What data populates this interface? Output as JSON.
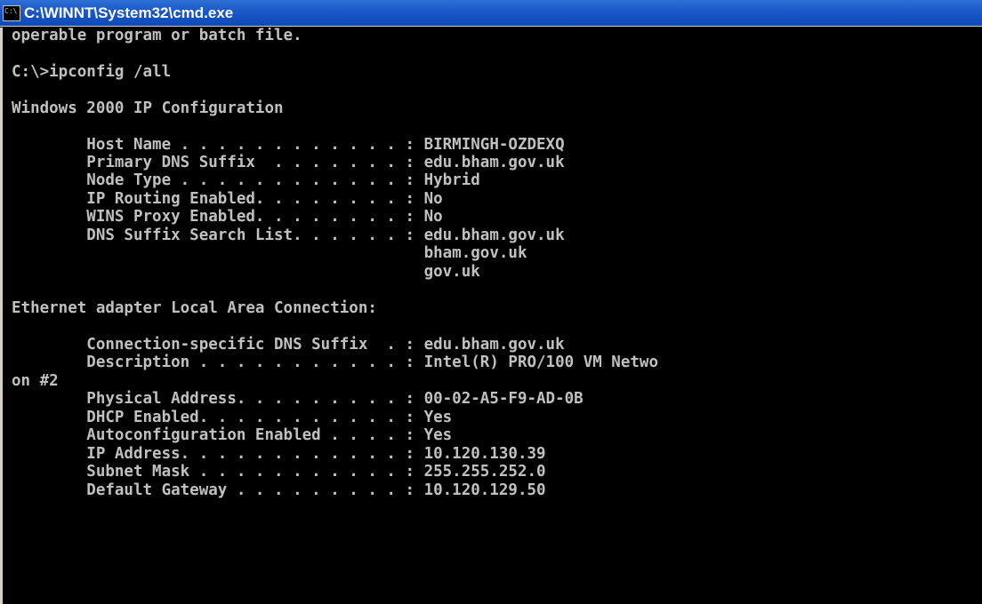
{
  "window": {
    "title": "C:\\WINNT\\System32\\cmd.exe",
    "icon": "console-app-icon"
  },
  "console": {
    "lines": [
      "operable program or batch file.",
      "C:\\>ipconfig /all",
      "Windows 2000 IP Configuration",
      "        Host Name . . . . . . . . . . . . : BIRMINGH-OZDEXQ",
      "        Primary DNS Suffix  . . . . . . . : edu.bham.gov.uk",
      "        Node Type . . . . . . . . . . . . : Hybrid",
      "        IP Routing Enabled. . . . . . . . : No",
      "        WINS Proxy Enabled. . . . . . . . : No",
      "        DNS Suffix Search List. . . . . . : edu.bham.gov.uk",
      "                                            bham.gov.uk",
      "                                            gov.uk",
      "Ethernet adapter Local Area Connection:",
      "        Connection-specific DNS Suffix  . : edu.bham.gov.uk",
      "        Description . . . . . . . . . . . : Intel(R) PRO/100 VM Netwo",
      "on #2",
      "        Physical Address. . . . . . . . . : 00-02-A5-F9-AD-0B",
      "        DHCP Enabled. . . . . . . . . . . : Yes",
      "        Autoconfiguration Enabled . . . . : Yes",
      "        IP Address. . . . . . . . . . . . : 10.120.130.39",
      "        Subnet Mask . . . . . . . . . . . : 255.255.252.0",
      "        Default Gateway . . . . . . . . . : 10.120.129.50"
    ]
  },
  "colors": {
    "titlebar": "#1a57c8",
    "title_text": "#ffffff",
    "console_bg": "#000000",
    "console_text": "#c0c0c0"
  }
}
